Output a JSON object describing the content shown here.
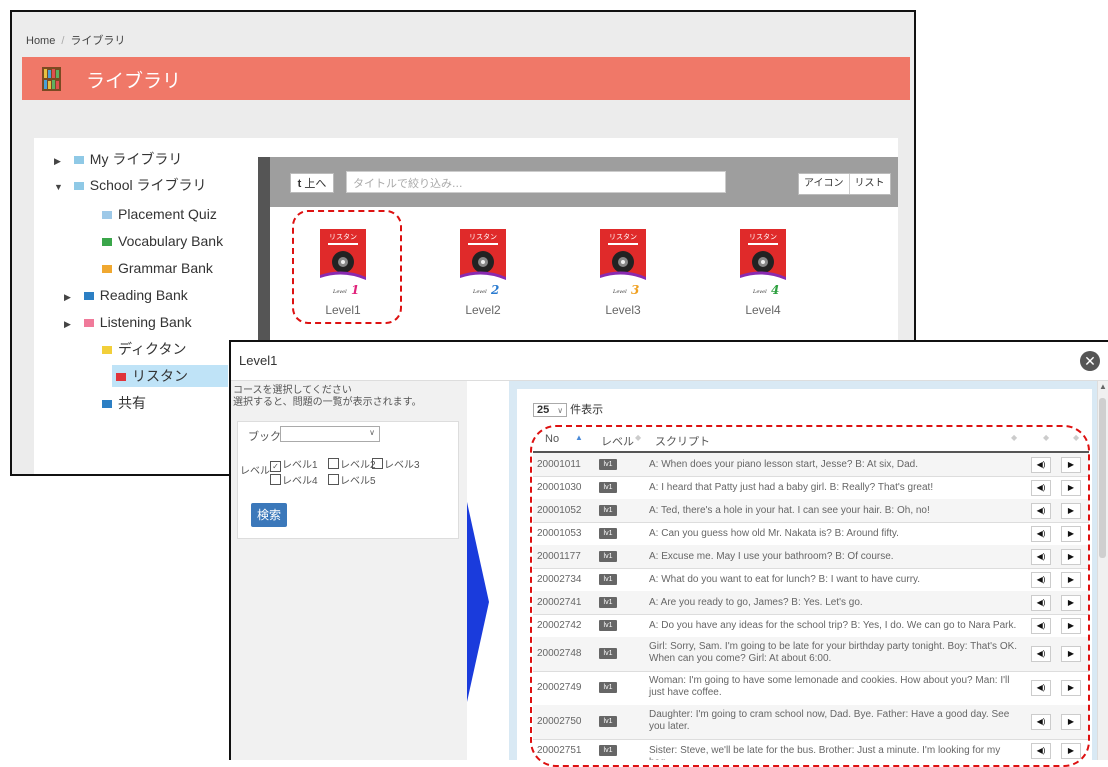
{
  "breadcrumb": {
    "home": "Home",
    "separator": "/",
    "current": "ライブラリ"
  },
  "header": {
    "title": "ライブラリ"
  },
  "tree": {
    "items": [
      {
        "label": "My ライブラリ",
        "expander": "▶",
        "color": "#8fc9e6"
      },
      {
        "label": "School ライブラリ",
        "expander": "▼",
        "color": "#8fc9e6"
      },
      {
        "label": "Placement Quiz",
        "expander": "",
        "color": "#9ec9e8"
      },
      {
        "label": "Vocabulary Bank",
        "expander": "",
        "color": "#3aa64a"
      },
      {
        "label": "Grammar Bank",
        "expander": "",
        "color": "#f0a830"
      },
      {
        "label": "Reading Bank",
        "expander": "▶",
        "color": "#2c7fc4"
      },
      {
        "label": "Listening Bank",
        "expander": "▶",
        "color": "#f07a9a"
      },
      {
        "label": "ディクタン",
        "expander": "",
        "color": "#f2cf3a"
      },
      {
        "label": "リスタン",
        "expander": "",
        "color": "#e0333a"
      },
      {
        "label": "共有",
        "expander": "",
        "color": "#2c7fc4"
      }
    ]
  },
  "library": {
    "up_label": "上へ",
    "up_icon": "up-arrow-icon",
    "filter_placeholder": "タイトルで絞り込み...",
    "view_icon_label": "アイコン",
    "view_list_label": "リスト",
    "book_cover_title": "リスタン",
    "books": [
      {
        "label": "Level1",
        "num": "1",
        "num_color": "#e0227a"
      },
      {
        "label": "Level2",
        "num": "2",
        "num_color": "#2a7bd0"
      },
      {
        "label": "Level3",
        "num": "3",
        "num_color": "#f0a020"
      },
      {
        "label": "Level4",
        "num": "4",
        "num_color": "#2ea040"
      }
    ]
  },
  "modal": {
    "title": "Level1",
    "close_icon": "close-icon",
    "hint_line1": "コースを選択してください",
    "hint_line2": "選択すると、問題の一覧が表示されます。",
    "book_label": "ブック",
    "level_label": "レベル",
    "levels": [
      {
        "label": "レベル1",
        "checked": true
      },
      {
        "label": "レベル2",
        "checked": false
      },
      {
        "label": "レベル3",
        "checked": false
      },
      {
        "label": "レベル4",
        "checked": false
      },
      {
        "label": "レベル5",
        "checked": false
      }
    ],
    "search_label": "検索",
    "per_page_value": "25",
    "per_page_suffix": "件表示",
    "col_no": "No",
    "col_level": "レベル",
    "col_script": "スクリプト",
    "level_badge": "lv1",
    "rows": [
      {
        "no": "20001011",
        "script": "A: When does your piano lesson start, Jesse? B: At six, Dad."
      },
      {
        "no": "20001030",
        "script": "A: I heard that Patty just had a baby girl. B: Really? That's great!"
      },
      {
        "no": "20001052",
        "script": "A: Ted, there's a hole in your hat. I can see your hair. B: Oh, no!"
      },
      {
        "no": "20001053",
        "script": "A: Can you guess how old Mr. Nakata is? B: Around fifty."
      },
      {
        "no": "20001177",
        "script": "A: Excuse me. May I use your bathroom? B: Of course."
      },
      {
        "no": "20002734",
        "script": "A: What do you want to eat for lunch? B: I want to have curry."
      },
      {
        "no": "20002741",
        "script": "A: Are you ready to go, James? B: Yes. Let's go."
      },
      {
        "no": "20002742",
        "script": "A: Do you have any ideas for the school trip? B: Yes, I do. We can go to Nara Park."
      },
      {
        "no": "20002748",
        "script": "Girl: Sorry, Sam. I'm going to be late for your birthday party tonight. Boy: That's OK. When can you come? Girl: At about 6:00."
      },
      {
        "no": "20002749",
        "script": "Woman: I'm going to have some lemonade and cookies. How about you? Man: I'll just have coffee."
      },
      {
        "no": "20002750",
        "script": "Daughter: I'm going to cram school now, Dad. Bye. Father: Have a good day. See you later."
      },
      {
        "no": "20002751",
        "script": "Sister: Steve, we'll be late for the bus. Brother: Just a minute. I'm looking for my bag."
      }
    ]
  }
}
